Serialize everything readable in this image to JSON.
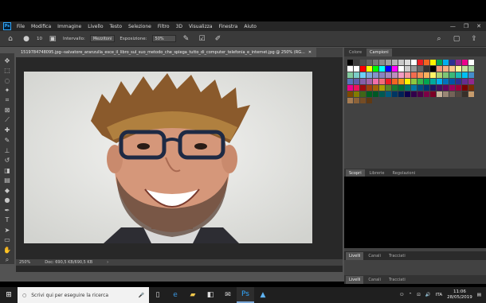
{
  "menubar": {
    "logo": "Ps",
    "items": [
      "File",
      "Modifica",
      "Immagine",
      "Livello",
      "Testo",
      "Selezione",
      "Filtro",
      "3D",
      "Visualizza",
      "Finestra",
      "Aiuto"
    ]
  },
  "options": {
    "brush_size": "10",
    "range_label": "Intervallo:",
    "range_value": "Mezzitoni",
    "exposure_label": "Esposizione:",
    "exposure_value": "50%"
  },
  "document": {
    "tab_title": "1519784748095.jpg--salvatore_aranzulla_esce_il_libro_sul_suo_metodo_che_spiega_tutto_di_computer_telefonia_e_internet.jpg @ 250% (RG..."
  },
  "statusbar": {
    "zoom": "250%",
    "doc_size": "Doc: 690,5 KB/690,5 KB"
  },
  "panels": {
    "color_tabs": [
      "Colore",
      "Campioni"
    ],
    "active_color_tab": "Campioni",
    "history_tabs": [
      "Scopri",
      "Librerie",
      "Regolazioni"
    ],
    "layers_tabs_top": [
      "Livelli",
      "Canali",
      "Tracciati"
    ],
    "layers_tabs_bottom": [
      "Livelli",
      "Canali",
      "Tracciati"
    ]
  },
  "swatch_colors": [
    "#000000",
    "#3c3c3c",
    "#505050",
    "#646464",
    "#787878",
    "#8c8c8c",
    "#a0a0a0",
    "#b4b4b4",
    "#c8c8c8",
    "#dcdcdc",
    "#ffffff",
    "#ed1c24",
    "#f26522",
    "#fff200",
    "#00a651",
    "#00aeef",
    "#2e3192",
    "#92278f",
    "#ec008c",
    "#ffffff",
    "#ffffff",
    "#ffffff",
    "#ff0000",
    "#ffff00",
    "#00ff00",
    "#00ffff",
    "#0000ff",
    "#ff00ff",
    "#ffffff",
    "#cccccc",
    "#999999",
    "#666666",
    "#333333",
    "#000000",
    "#f7977a",
    "#f9ad81",
    "#fdc68a",
    "#fff79a",
    "#c4df9b",
    "#a3d39c",
    "#82ca9d",
    "#7bcdc8",
    "#6ecff6",
    "#7ea7d8",
    "#8493ca",
    "#8882be",
    "#a187be",
    "#bc8dbf",
    "#f49ac2",
    "#f6989d",
    "#f26c4f",
    "#f68e55",
    "#fbaf5c",
    "#fff467",
    "#acd372",
    "#7cc576",
    "#3bb878",
    "#1abbb4",
    "#00bff3",
    "#438ccb",
    "#5574b9",
    "#605ca8",
    "#855fa8",
    "#a763a8",
    "#f06eaa",
    "#f26d7d",
    "#ed1c24",
    "#f26522",
    "#f7941d",
    "#fff200",
    "#8dc73f",
    "#39b54a",
    "#00a651",
    "#00a99d",
    "#00aeef",
    "#0072bc",
    "#0054a6",
    "#2e3192",
    "#662d91",
    "#92278f",
    "#ec008c",
    "#ed145b",
    "#9e0b0f",
    "#a0410d",
    "#a3620a",
    "#aba000",
    "#598527",
    "#197b30",
    "#007236",
    "#00746b",
    "#0076a3",
    "#004b80",
    "#003471",
    "#1b1464",
    "#440e62",
    "#630460",
    "#9e005d",
    "#9e0039",
    "#790000",
    "#7b2e00",
    "#7d4900",
    "#827b00",
    "#406618",
    "#005e20",
    "#005826",
    "#005952",
    "#005b7f",
    "#003663",
    "#002157",
    "#0d004c",
    "#32004b",
    "#4b0049",
    "#7b0046",
    "#7a0026",
    "#c7b299",
    "#998675",
    "#736357",
    "#534741",
    "#37302a",
    "#c69c6d",
    "#a67c52",
    "#8c6239",
    "#754c24",
    "#603913"
  ],
  "taskbar": {
    "search_placeholder": "Scrivi qui per eseguire la ricerca",
    "language": "ITA",
    "time": "11:06",
    "date": "28/05/2019"
  }
}
